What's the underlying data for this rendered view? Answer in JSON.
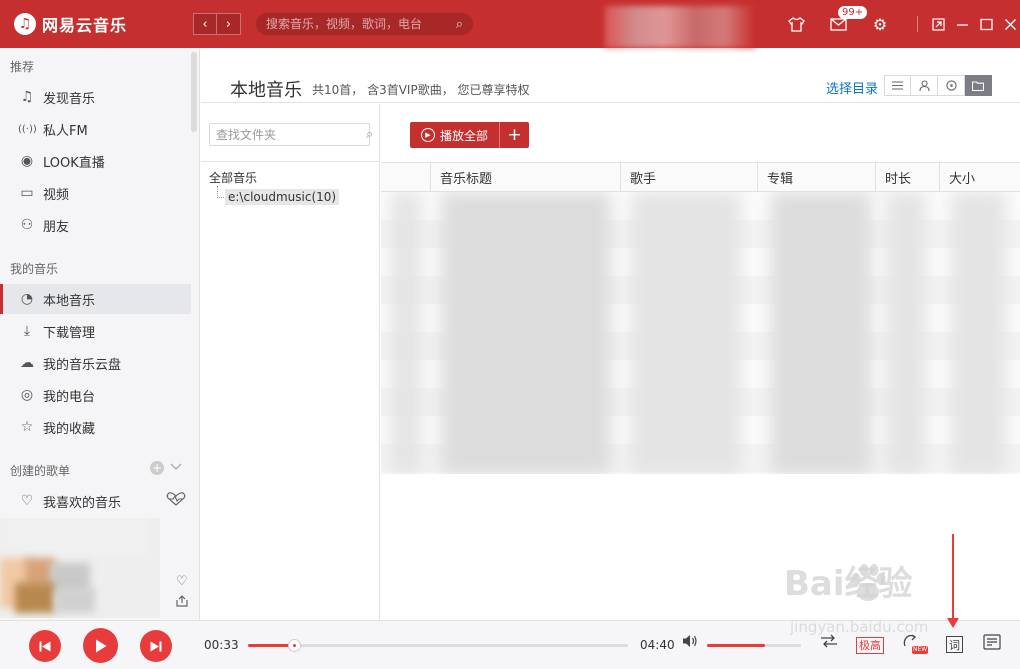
{
  "app": {
    "logo_glyph": "♫",
    "name": "网易云音乐",
    "accent": "#c62f2f"
  },
  "topbar": {
    "back_icon": "‹",
    "forward_icon": "›",
    "search_placeholder": "搜索音乐，视频，歌词，电台",
    "message_badge": "99+",
    "icons": [
      "skin-icon",
      "mail-icon",
      "gear-icon",
      "mini-mode-icon",
      "minimize-icon",
      "maximize-icon",
      "close-icon"
    ]
  },
  "sidebar": {
    "recommend_title": "推荐",
    "recommend_items": [
      {
        "icon": "♫",
        "label": "发现音乐"
      },
      {
        "icon": "((·))",
        "label": "私人FM"
      },
      {
        "icon": "◉",
        "label": "LOOK直播"
      },
      {
        "icon": "▭",
        "label": "视频"
      },
      {
        "icon": "⚇",
        "label": "朋友"
      }
    ],
    "mymusic_title": "我的音乐",
    "mymusic_items": [
      {
        "icon": "◔",
        "label": "本地音乐",
        "active": true
      },
      {
        "icon": "⤓",
        "label": "下载管理"
      },
      {
        "icon": "☁",
        "label": "我的音乐云盘"
      },
      {
        "icon": "◎",
        "label": "我的电台"
      },
      {
        "icon": "☆",
        "label": "我的收藏"
      }
    ],
    "created_title": "创建的歌单",
    "created_items": [
      {
        "icon": "♡",
        "label": "我喜欢的音乐"
      }
    ]
  },
  "main": {
    "title": "本地音乐",
    "subtitle": "共10首， 含3首VIP歌曲， 您已尊享特权",
    "choose_dir": "选择目录",
    "folder_search_placeholder": "查找文件夹",
    "tree_root": "全部音乐",
    "tree_node": "e:\\cloudmusic(10)",
    "play_all": "播放全部",
    "add_label": "+",
    "columns": [
      "音乐标题",
      "歌手",
      "专辑",
      "时长",
      "大小"
    ]
  },
  "player": {
    "current_time": "00:33",
    "total_time": "04:40",
    "progress": 0.12,
    "volume": 0.62,
    "quality": "极高",
    "new_tag": "NEW",
    "lyric": "词"
  },
  "watermark": {
    "main": "Bai经验",
    "sub": "jingyan.baidu.com"
  }
}
